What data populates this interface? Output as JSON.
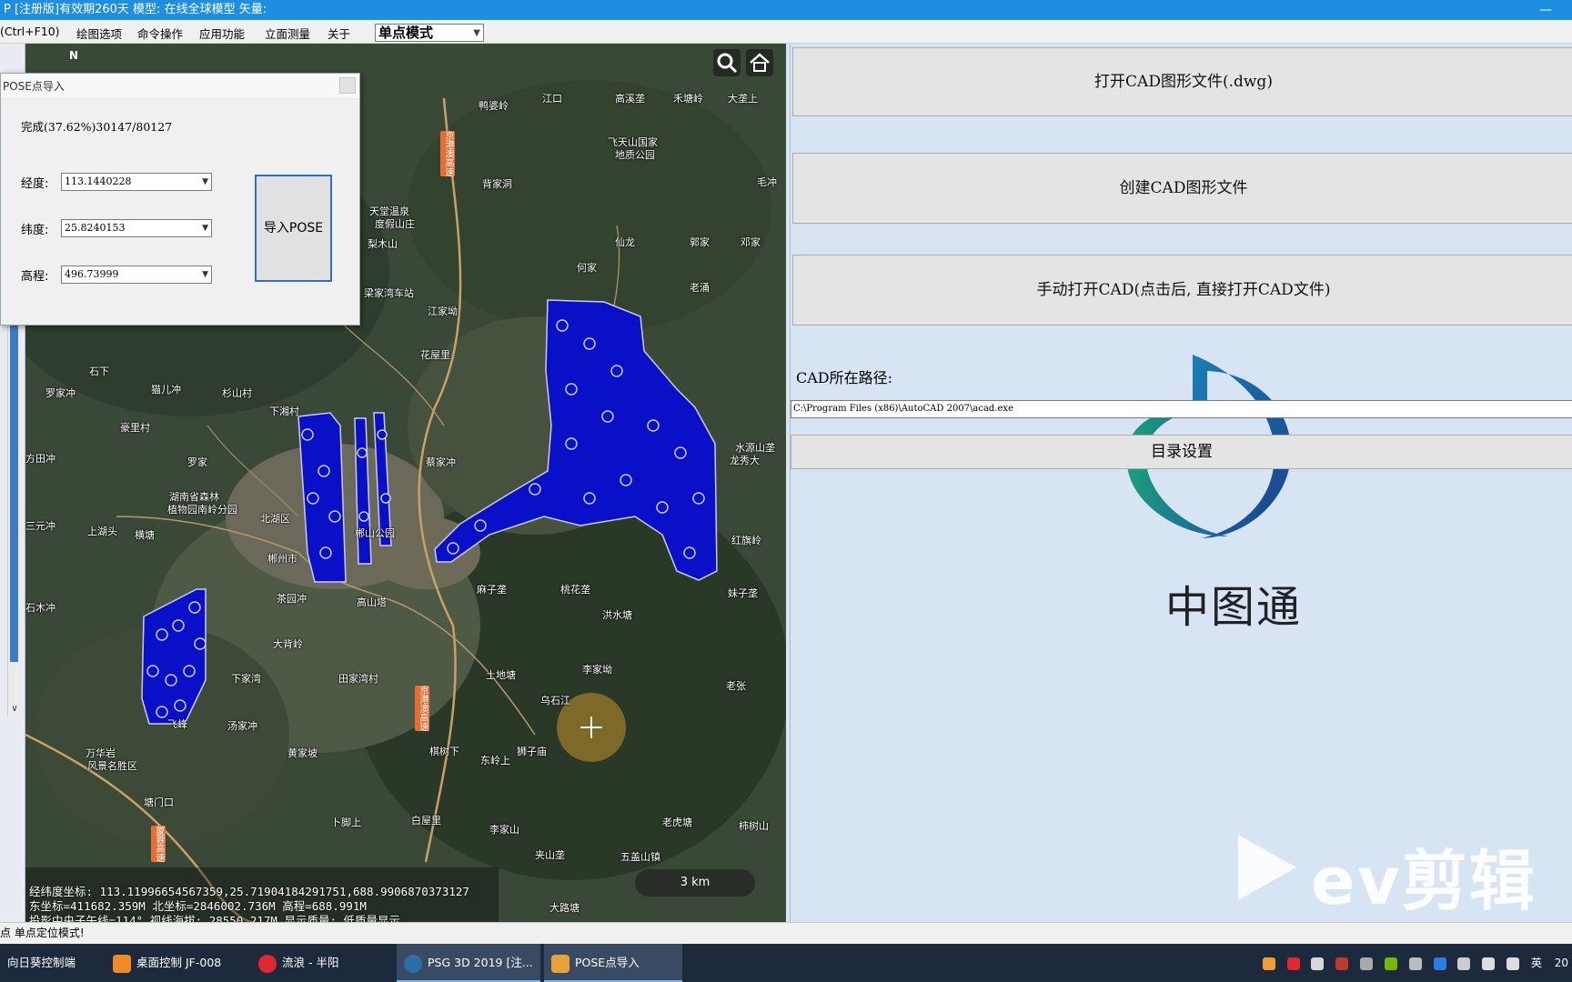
{
  "titlebar": {
    "text": "P [注册版]有效期260天 模型: 在线全球模型  矢量:"
  },
  "menubar": {
    "items": [
      "(Ctrl+F10)",
      "绘图选项",
      "命令操作",
      "应用功能",
      "立面测量",
      "关于"
    ],
    "mode_select": "单点模式"
  },
  "dialog": {
    "title": "POSE点导入",
    "progress": "完成(37.62%)30147/80127",
    "longitude_label": "经度:",
    "longitude_value": "113.1440228",
    "latitude_label": "纬度:",
    "latitude_value": "25.8240153",
    "elevation_label": "高程:",
    "elevation_value": "496.73999",
    "import_button": "导入POSE"
  },
  "map": {
    "labels": [
      "鸭婆岭",
      "江口",
      "高溪垄",
      "禾塘岭",
      "大垄上",
      "飞天山国家",
      "地质公园",
      "背家洞",
      "天堂温泉",
      "度假山庄",
      "仙龙",
      "郭家",
      "梨木山",
      "何家",
      "邓家",
      "毛冲",
      "梁家湾车站",
      "江家坳",
      "花屋里",
      "猫儿冲",
      "罗家冲",
      "杉山村",
      "下湘村",
      "老涌",
      "石下",
      "蔡家冲",
      "罗家",
      "湖南省森林",
      "植物园南岭分园",
      "北湖区",
      "郴州市",
      "郴山公园",
      "茶园冲",
      "高山塔",
      "麻子垄",
      "桃花垄",
      "洪水塘",
      "大背岭",
      "下家湾",
      "田家湾村",
      "土地塘",
      "乌石江",
      "李家坳",
      "棋树下",
      "东岭上",
      "狮子庙",
      "万华岩",
      "风景名胜区",
      "塘门口",
      "飞峰",
      "汤家冲",
      "黄家坡",
      "白屋里",
      "老虎塘",
      "五盖山镇",
      "大路塘",
      "夹山垄",
      "李家山",
      "卜脚上",
      "柿树山",
      "龙秀大",
      "红旗岭",
      "水源山垄",
      "妹子垄",
      "方田冲",
      "豪里村",
      "三元冲",
      "上湖头",
      "石木冲",
      "横塘",
      "老张"
    ],
    "road_signs": [
      "京港澳高速",
      "京港澳高速",
      "厦蓉高速"
    ],
    "coord_line1": "经纬度坐标: 113.11996654567359,25.71904184291751,688.9906870373127",
    "coord_line2": "东坐标=411682.359M  北坐标=2846002.736M  高程=688.991M",
    "coord_line3": "投影中央子午线=114°   视线海拔: 28550.217M  显示质量: 低质量显示",
    "scale_label": "3 km",
    "compass_label": "N",
    "point_color": "#0a10c8"
  },
  "rightpanel": {
    "open_cad_button": "打开CAD图形文件(.dwg)",
    "create_cad_button": "创建CAD图形文件",
    "manual_open_button": "手动打开CAD(点击后, 直接打开CAD文件)",
    "path_label": "CAD所在路径:",
    "path_value": "C:\\Program Files (x86)\\AutoCAD 2007\\acad.exe",
    "dir_button": "目录设置",
    "logo_text": "中图通",
    "watermark": "ev剪辑"
  },
  "statusbar": {
    "text": "点  单点定位模式!"
  },
  "taskbar": {
    "items": [
      "向日葵控制端",
      "桌面控制  JF-008",
      "流浪 - 半阳",
      "PSG 3D 2019 [注...",
      "POSE点导入"
    ],
    "tray_lang": "英",
    "tray_time": "20"
  }
}
